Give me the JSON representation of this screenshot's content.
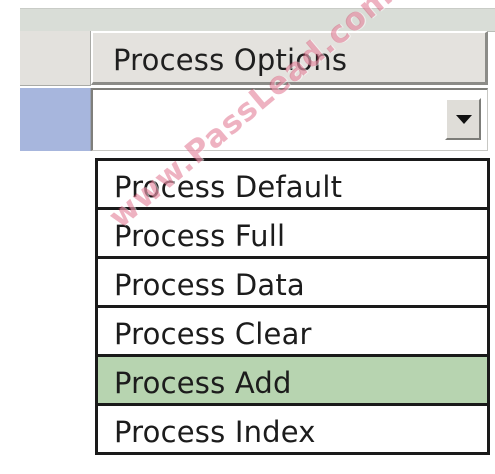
{
  "column_header": {
    "label": "Process Options"
  },
  "combo": {
    "value": "",
    "button_icon": "chevron-down-icon"
  },
  "options": [
    {
      "label": "Process Default",
      "selected": false
    },
    {
      "label": "Process Full",
      "selected": false
    },
    {
      "label": "Process Data",
      "selected": false
    },
    {
      "label": "Process Clear",
      "selected": false
    },
    {
      "label": "Process Add",
      "selected": true
    },
    {
      "label": "Process Index",
      "selected": false
    }
  ],
  "watermark": {
    "text": "www.PassLead.com"
  },
  "colors": {
    "selected_item": "#b7d4b0",
    "row_selector": "#a7b6dd",
    "watermark": "#d3345c"
  }
}
